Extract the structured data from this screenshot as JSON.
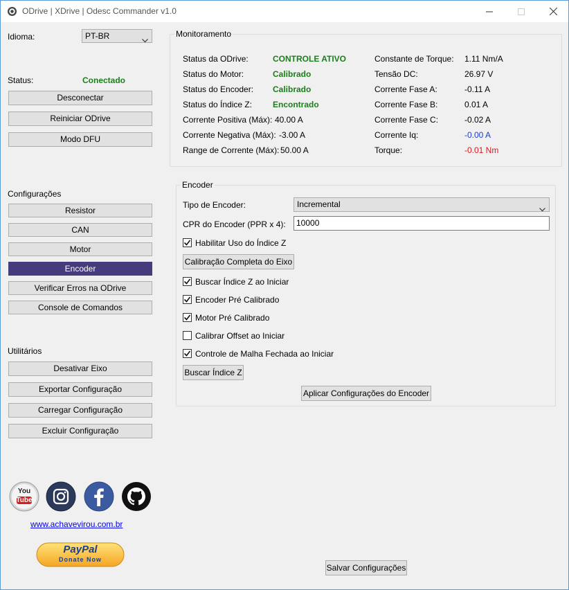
{
  "window": {
    "title": "ODrive | XDrive | Odesc Commander v1.0"
  },
  "sidebar": {
    "language_label": "Idioma:",
    "language_value": "PT-BR",
    "status_label": "Status:",
    "status_value": "Conectado",
    "top_buttons": [
      "Desconectar",
      "Reiniciar ODrive",
      "Modo DFU"
    ],
    "config_heading": "Configurações",
    "config_buttons": [
      "Resistor",
      "CAN",
      "Motor",
      "Encoder",
      "Verificar Erros na ODrive",
      "Console de Comandos"
    ],
    "utils_heading": "Utilitários",
    "util_buttons": [
      "Desativar Eixo",
      "Exportar Configuração",
      "Carregar Configuração",
      "Excluir Configuração"
    ],
    "website": "www.achavevirou.com.br",
    "youtube_text_top": "You",
    "youtube_text_bottom": "Tube",
    "paypal_text": "PayPal",
    "paypal_donate": "Donate Now"
  },
  "monitor": {
    "title": "Monitoramento",
    "left": [
      {
        "label": "Status da ODrive:",
        "value": "CONTROLE ATIVO"
      },
      {
        "label": "Status do Motor:",
        "value": "Calibrado"
      },
      {
        "label": "Status do Encoder:",
        "value": "Calibrado"
      },
      {
        "label": "Status do Índice Z:",
        "value": "Encontrado"
      },
      {
        "label": "Corrente Positiva (Máx):",
        "value": "40.00 A"
      },
      {
        "label": "Corrente Negativa (Máx):",
        "value": "-3.00 A"
      },
      {
        "label": "Range de Corrente (Máx):",
        "value": "50.00 A"
      }
    ],
    "right": [
      {
        "label": "Constante de Torque:",
        "value": "1.11 Nm/A"
      },
      {
        "label": "Tensão DC:",
        "value": "26.97 V"
      },
      {
        "label": "Corrente Fase A:",
        "value": "-0.11 A"
      },
      {
        "label": "Corrente Fase B:",
        "value": "0.01 A"
      },
      {
        "label": "Corrente Fase C:",
        "value": "-0.02 A"
      },
      {
        "label": "Corrente Iq:",
        "value": "-0.00 A"
      },
      {
        "label": "Torque:",
        "value": "-0.01 Nm"
      }
    ]
  },
  "encoder": {
    "title": "Encoder",
    "type_label": "Tipo de Encoder:",
    "type_value": "Incremental",
    "cpr_label": "CPR do Encoder (PPR x 4):",
    "cpr_value": "10000",
    "index_checkbox": "Habilitar Uso do Índice Z",
    "calib_button": "Calibração Completa do Eixo",
    "checkboxes": [
      {
        "label": "Buscar Índice Z ao Iniciar",
        "checked": true
      },
      {
        "label": "Encoder Pré Calibrado",
        "checked": true
      },
      {
        "label": "Motor Pré Calibrado",
        "checked": true
      },
      {
        "label": "Calibrar Offset ao Iniciar",
        "checked": false
      },
      {
        "label": "Controle de Malha Fechada ao Iniciar",
        "checked": true
      }
    ],
    "search_button": "Buscar Índice Z",
    "apply_button": "Aplicar Configurações do Encoder"
  },
  "footer": {
    "save_button": "Salvar Configurações"
  },
  "colors": {
    "accent": "#453b7d",
    "status_green": "#1a7f1a",
    "value_blue": "#1b3fc9",
    "value_red": "#e0141e"
  }
}
